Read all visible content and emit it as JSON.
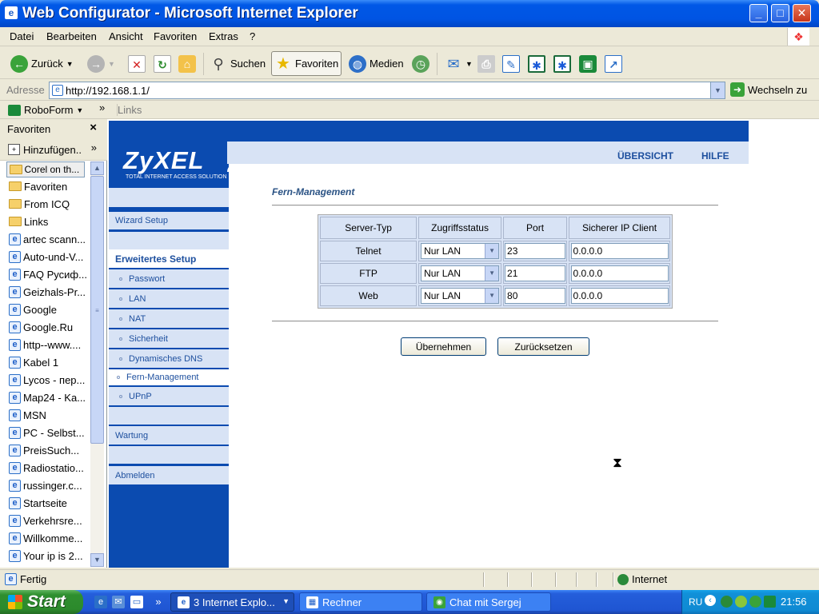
{
  "window": {
    "title": "Web Configurator - Microsoft Internet Explorer",
    "icon": "ie-page-icon",
    "buttons": [
      "minimize",
      "maximize",
      "close"
    ]
  },
  "menubar": [
    "Datei",
    "Bearbeiten",
    "Ansicht",
    "Favoriten",
    "Extras",
    "?"
  ],
  "toolbar": {
    "back": "Zurück",
    "search": "Suchen",
    "favorites": "Favoriten",
    "media": "Medien"
  },
  "address": {
    "label": "Adresse",
    "url": "http://192.168.1.1/",
    "go": "Wechseln zu"
  },
  "linksbar": {
    "roboform": "RoboForm",
    "links": "Links"
  },
  "favorites_pane": {
    "title": "Favoriten",
    "add": "Hinzufügen..",
    "items": [
      {
        "label": "Corel on th...",
        "type": "folder"
      },
      {
        "label": "Favoriten",
        "type": "folder"
      },
      {
        "label": "From ICQ",
        "type": "folder"
      },
      {
        "label": "Links",
        "type": "folder"
      },
      {
        "label": "artec scann...",
        "type": "link"
      },
      {
        "label": "Auto-und-V...",
        "type": "link"
      },
      {
        "label": "FAQ Русиф...",
        "type": "link"
      },
      {
        "label": "Geizhals-Pr...",
        "type": "link"
      },
      {
        "label": "Google",
        "type": "link"
      },
      {
        "label": "Google.Ru",
        "type": "link"
      },
      {
        "label": "http--www....",
        "type": "link"
      },
      {
        "label": "Kabel 1",
        "type": "link"
      },
      {
        "label": "Lycos - пер...",
        "type": "link"
      },
      {
        "label": "Map24 - Ka...",
        "type": "link"
      },
      {
        "label": "MSN",
        "type": "link"
      },
      {
        "label": "PC - Selbst...",
        "type": "link"
      },
      {
        "label": "PreisSuch...",
        "type": "link"
      },
      {
        "label": "Radiostatio...",
        "type": "link"
      },
      {
        "label": "russinger.c...",
        "type": "link"
      },
      {
        "label": "Startseite",
        "type": "link"
      },
      {
        "label": "Verkehrsre...",
        "type": "link"
      },
      {
        "label": "Willkomme...",
        "type": "link"
      },
      {
        "label": "Your ip is 2...",
        "type": "link"
      }
    ]
  },
  "zyxel": {
    "logo": "ZyXEL",
    "tagline": "TOTAL INTERNET ACCESS SOLUTION",
    "top_links": [
      "ÜBERSICHT",
      "HILFE"
    ],
    "nav": {
      "wizard": "Wizard Setup",
      "advanced": "Erweitertes Setup",
      "sub": [
        "Passwort",
        "LAN",
        "NAT",
        "Sicherheit",
        "Dynamisches DNS",
        "Fern-Management",
        "UPnP"
      ],
      "maintenance": "Wartung",
      "logout": "Abmelden"
    },
    "section_title": "Fern-Management",
    "table": {
      "headers": [
        "Server-Typ",
        "Zugriffsstatus",
        "Port",
        "Sicherer IP Client"
      ],
      "rows": [
        {
          "type": "Telnet",
          "access": "Nur LAN",
          "port": "23",
          "ip": "0.0.0.0"
        },
        {
          "type": "FTP",
          "access": "Nur LAN",
          "port": "21",
          "ip": "0.0.0.0"
        },
        {
          "type": "Web",
          "access": "Nur LAN",
          "port": "80",
          "ip": "0.0.0.0"
        }
      ]
    },
    "apply": "Übernehmen",
    "reset": "Zurücksetzen"
  },
  "statusbar": {
    "status": "Fertig",
    "zone": "Internet"
  },
  "taskbar": {
    "start": "Start",
    "tasks": [
      "3 Internet Explo...",
      "Rechner",
      "Chat mit Sergej"
    ],
    "lang": "RU",
    "clock": "21:56"
  }
}
